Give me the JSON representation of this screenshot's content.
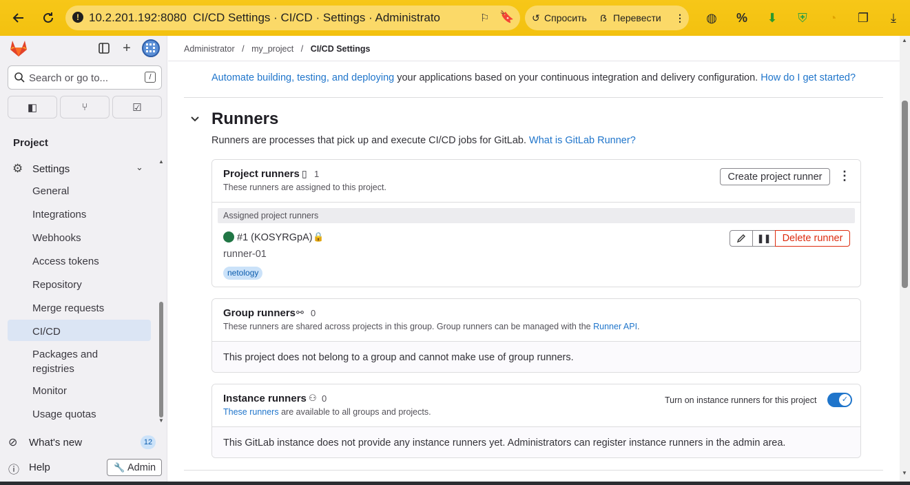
{
  "browser": {
    "url": "10.2.201.192:8080",
    "title": "CI/CD Settings · CI/CD · Settings · Administrator /...",
    "ask_label": "Спросить",
    "translate_label": "Перевести"
  },
  "sidebar": {
    "search_placeholder": "Search or go to...",
    "search_shortcut": "/",
    "section": "Project",
    "settings_label": "Settings",
    "items": [
      {
        "label": "General"
      },
      {
        "label": "Integrations"
      },
      {
        "label": "Webhooks"
      },
      {
        "label": "Access tokens"
      },
      {
        "label": "Repository"
      },
      {
        "label": "Merge requests"
      },
      {
        "label": "CI/CD"
      },
      {
        "label": "Packages and registries"
      },
      {
        "label": "Monitor"
      },
      {
        "label": "Usage quotas"
      }
    ],
    "whats_new": "What's new",
    "whats_new_count": "12",
    "help": "Help",
    "admin": "Admin"
  },
  "breadcrumb": {
    "items": [
      "Administrator",
      "my_project",
      "CI/CD Settings"
    ]
  },
  "pipelines_intro": {
    "link_text": "Automate building, testing, and deploying",
    "rest": " your applications based on your continuous integration and delivery configuration. ",
    "help_link": "How do I get started?"
  },
  "runners": {
    "title": "Runners",
    "desc": "Runners are processes that pick up and execute CI/CD jobs for GitLab. ",
    "desc_link": "What is GitLab Runner?",
    "project": {
      "title": "Project runners",
      "count": "1",
      "desc": "These runners are assigned to this project.",
      "create_button": "Create project runner",
      "assigned_header": "Assigned project runners",
      "runner": {
        "name": "#1 (KOSYRGpA)",
        "description": "runner-01",
        "tag": "netology",
        "delete_label": "Delete runner"
      }
    },
    "group": {
      "title": "Group runners",
      "count": "0",
      "desc": "These runners are shared across projects in this group. Group runners can be managed with the ",
      "desc_link": "Runner API",
      "desc_end": ".",
      "body": "This project does not belong to a group and cannot make use of group runners."
    },
    "instance": {
      "title": "Instance runners",
      "count": "0",
      "desc_link": "These runners",
      "desc": " are available to all groups and projects.",
      "toggle_label": "Turn on instance runners for this project",
      "toggle_on": true,
      "body": "This GitLab instance does not provide any instance runners yet. Administrators can register instance runners in the admin area."
    }
  },
  "colors": {
    "accent": "#1f75cb",
    "online": "#217645",
    "danger": "#dd2b0e",
    "active_nav": "#dbe5f4"
  }
}
